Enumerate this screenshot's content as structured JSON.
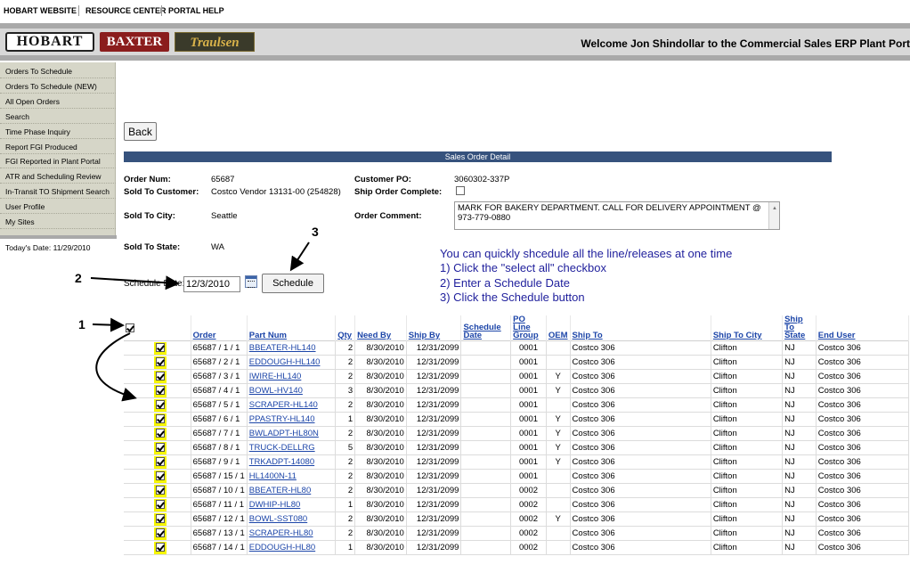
{
  "top_links": [
    "HOBART WEBSITE",
    "RESOURCE CENTER",
    "PORTAL HELP"
  ],
  "brand": {
    "hobart": "HOBART",
    "baxter": "BAXTER",
    "traulsen": "Traulsen"
  },
  "welcome": "Welcome Jon Shindollar to the Commercial Sales ERP Plant Port",
  "nav": [
    "Orders To Schedule",
    "Orders To Schedule (NEW)",
    "All Open Orders",
    "Search",
    "Time Phase Inquiry",
    "Report FGI Produced",
    "FGI Reported in Plant Portal",
    "ATR and Scheduling Review",
    "In-Transit TO Shipment Search",
    "User Profile",
    "My Sites"
  ],
  "today": "Today's Date: 11/29/2010",
  "back_label": "Back",
  "section_title": "Sales Order Detail",
  "order": {
    "num_label": "Order Num:",
    "num": "65687",
    "customer_label": "Sold To Customer:",
    "customer": "Costco Vendor 13131-00 (254828)",
    "city_label": "Sold To City:",
    "city": "Seattle",
    "state_label": "Sold To State:",
    "state": "WA",
    "po_label": "Customer PO:",
    "po": "3060302-337P",
    "complete_label": "Ship Order Complete:",
    "comment_label": "Order Comment:",
    "comment": "MARK FOR BAKERY DEPARTMENT.  CALL FOR DELIVERY APPOINTMENT @ 973-779-0880"
  },
  "schedule": {
    "label": "Schedule Date:",
    "value": "12/3/2010",
    "button": "Schedule"
  },
  "instructions": [
    "You can quickly shcedule all the line/releases at one time",
    "1) Click the \"select all\" checkbox",
    "2) Enter a Schedule Date",
    "3) Click the Schedule button"
  ],
  "steps": [
    "1",
    "2",
    "3"
  ],
  "columns": [
    "Order",
    "Part Num",
    "Qty",
    "Need By",
    "Ship By",
    "Schedule Date",
    "PO Line Group",
    "OEM",
    "Ship To",
    "Ship To City",
    "Ship To State",
    "End User"
  ],
  "rows": [
    [
      "65687 / 1 / 1",
      "BBEATER-HL140",
      "2",
      "8/30/2010",
      "12/31/2099",
      "",
      "0001",
      "",
      "Costco 306",
      "Clifton",
      "NJ",
      "Costco 306"
    ],
    [
      "65687 / 2 / 1",
      "EDDOUGH-HL140",
      "2",
      "8/30/2010",
      "12/31/2099",
      "",
      "0001",
      "",
      "Costco 306",
      "Clifton",
      "NJ",
      "Costco 306"
    ],
    [
      "65687 / 3 / 1",
      "IWIRE-HL140",
      "2",
      "8/30/2010",
      "12/31/2099",
      "",
      "0001",
      "Y",
      "Costco 306",
      "Clifton",
      "NJ",
      "Costco 306"
    ],
    [
      "65687 / 4 / 1",
      "BOWL-HV140",
      "3",
      "8/30/2010",
      "12/31/2099",
      "",
      "0001",
      "Y",
      "Costco 306",
      "Clifton",
      "NJ",
      "Costco 306"
    ],
    [
      "65687 / 5 / 1",
      "SCRAPER-HL140",
      "2",
      "8/30/2010",
      "12/31/2099",
      "",
      "0001",
      "",
      "Costco 306",
      "Clifton",
      "NJ",
      "Costco 306"
    ],
    [
      "65687 / 6 / 1",
      "PPASTRY-HL140",
      "1",
      "8/30/2010",
      "12/31/2099",
      "",
      "0001",
      "Y",
      "Costco 306",
      "Clifton",
      "NJ",
      "Costco 306"
    ],
    [
      "65687 / 7 / 1",
      "BWLADPT-HL80N",
      "2",
      "8/30/2010",
      "12/31/2099",
      "",
      "0001",
      "Y",
      "Costco 306",
      "Clifton",
      "NJ",
      "Costco 306"
    ],
    [
      "65687 / 8 / 1",
      "TRUCK-DELLRG",
      "5",
      "8/30/2010",
      "12/31/2099",
      "",
      "0001",
      "Y",
      "Costco 306",
      "Clifton",
      "NJ",
      "Costco 306"
    ],
    [
      "65687 / 9 / 1",
      "TRKADPT-14080",
      "2",
      "8/30/2010",
      "12/31/2099",
      "",
      "0001",
      "Y",
      "Costco 306",
      "Clifton",
      "NJ",
      "Costco 306"
    ],
    [
      "65687 / 15 / 1",
      "HL1400N-11",
      "2",
      "8/30/2010",
      "12/31/2099",
      "",
      "0001",
      "",
      "Costco 306",
      "Clifton",
      "NJ",
      "Costco 306"
    ],
    [
      "65687 / 10 / 1",
      "BBEATER-HL80",
      "2",
      "8/30/2010",
      "12/31/2099",
      "",
      "0002",
      "",
      "Costco 306",
      "Clifton",
      "NJ",
      "Costco 306"
    ],
    [
      "65687 / 11 / 1",
      "DWHIP-HL80",
      "1",
      "8/30/2010",
      "12/31/2099",
      "",
      "0002",
      "",
      "Costco 306",
      "Clifton",
      "NJ",
      "Costco 306"
    ],
    [
      "65687 / 12 / 1",
      "BOWL-SST080",
      "2",
      "8/30/2010",
      "12/31/2099",
      "",
      "0002",
      "Y",
      "Costco 306",
      "Clifton",
      "NJ",
      "Costco 306"
    ],
    [
      "65687 / 13 / 1",
      "SCRAPER-HL80",
      "2",
      "8/30/2010",
      "12/31/2099",
      "",
      "0002",
      "",
      "Costco 306",
      "Clifton",
      "NJ",
      "Costco 306"
    ],
    [
      "65687 / 14 / 1",
      "EDDOUGH-HL80",
      "1",
      "8/30/2010",
      "12/31/2099",
      "",
      "0002",
      "",
      "Costco 306",
      "Clifton",
      "NJ",
      "Costco 306"
    ]
  ],
  "colors": {
    "section_bar": "#36527d",
    "link": "#1c45a8",
    "instruction": "#1f1f9c",
    "highlight": "#f6f600"
  }
}
